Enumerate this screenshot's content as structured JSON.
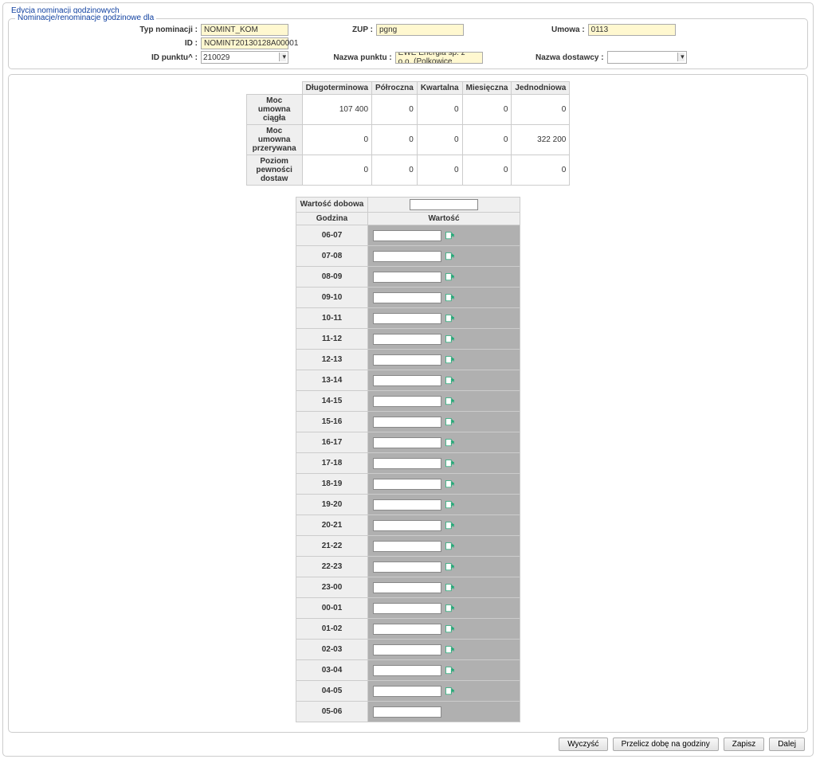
{
  "page": {
    "outer_title": "Edycja nominacji godzinowych",
    "inner_title": "Nominacje/renominacje godzinowe dla"
  },
  "form": {
    "typ_label": "Typ nominacji :",
    "typ_value": "NOMINT_KOM",
    "id_label": "ID :",
    "id_value": "NOMINT20130128A00001",
    "idpunktu_label": "ID punktu^ :",
    "idpunktu_value": "210029",
    "zup_label": "ZUP :",
    "zup_value": "pgng",
    "nazwapunktu_label": "Nazwa punktu :",
    "nazwapunktu_value": "EWE Energia sp. z o.o. (Polkowice",
    "umowa_label": "Umowa :",
    "umowa_value": "0113",
    "nazwadostawcy_label": "Nazwa dostawcy :",
    "nazwadostawcy_value": ""
  },
  "summary": {
    "cols": [
      "Długoterminowa",
      "Półroczna",
      "Kwartalna",
      "Miesięczna",
      "Jednodniowa"
    ],
    "rows": [
      {
        "label": "Moc umowna ciągła",
        "vals": [
          "107 400",
          "0",
          "0",
          "0",
          "0"
        ]
      },
      {
        "label": "Moc umowna przerywana",
        "vals": [
          "0",
          "0",
          "0",
          "0",
          "322 200"
        ]
      },
      {
        "label": "Poziom pewności dostaw",
        "vals": [
          "0",
          "0",
          "0",
          "0",
          "0"
        ]
      }
    ]
  },
  "hours": {
    "dobowa_label": "Wartość dobowa",
    "godzina_label": "Godzina",
    "wartosc_label": "Wartość",
    "list": [
      "06-07",
      "07-08",
      "08-09",
      "09-10",
      "10-11",
      "11-12",
      "12-13",
      "13-14",
      "14-15",
      "15-16",
      "16-17",
      "17-18",
      "18-19",
      "19-20",
      "20-21",
      "21-22",
      "22-23",
      "23-00",
      "00-01",
      "01-02",
      "02-03",
      "03-04",
      "04-05",
      "05-06"
    ]
  },
  "footer": {
    "wyczysc": "Wyczyść",
    "przelicz": "Przelicz dobę na godziny",
    "zapisz": "Zapisz",
    "dalej": "Dalej"
  }
}
